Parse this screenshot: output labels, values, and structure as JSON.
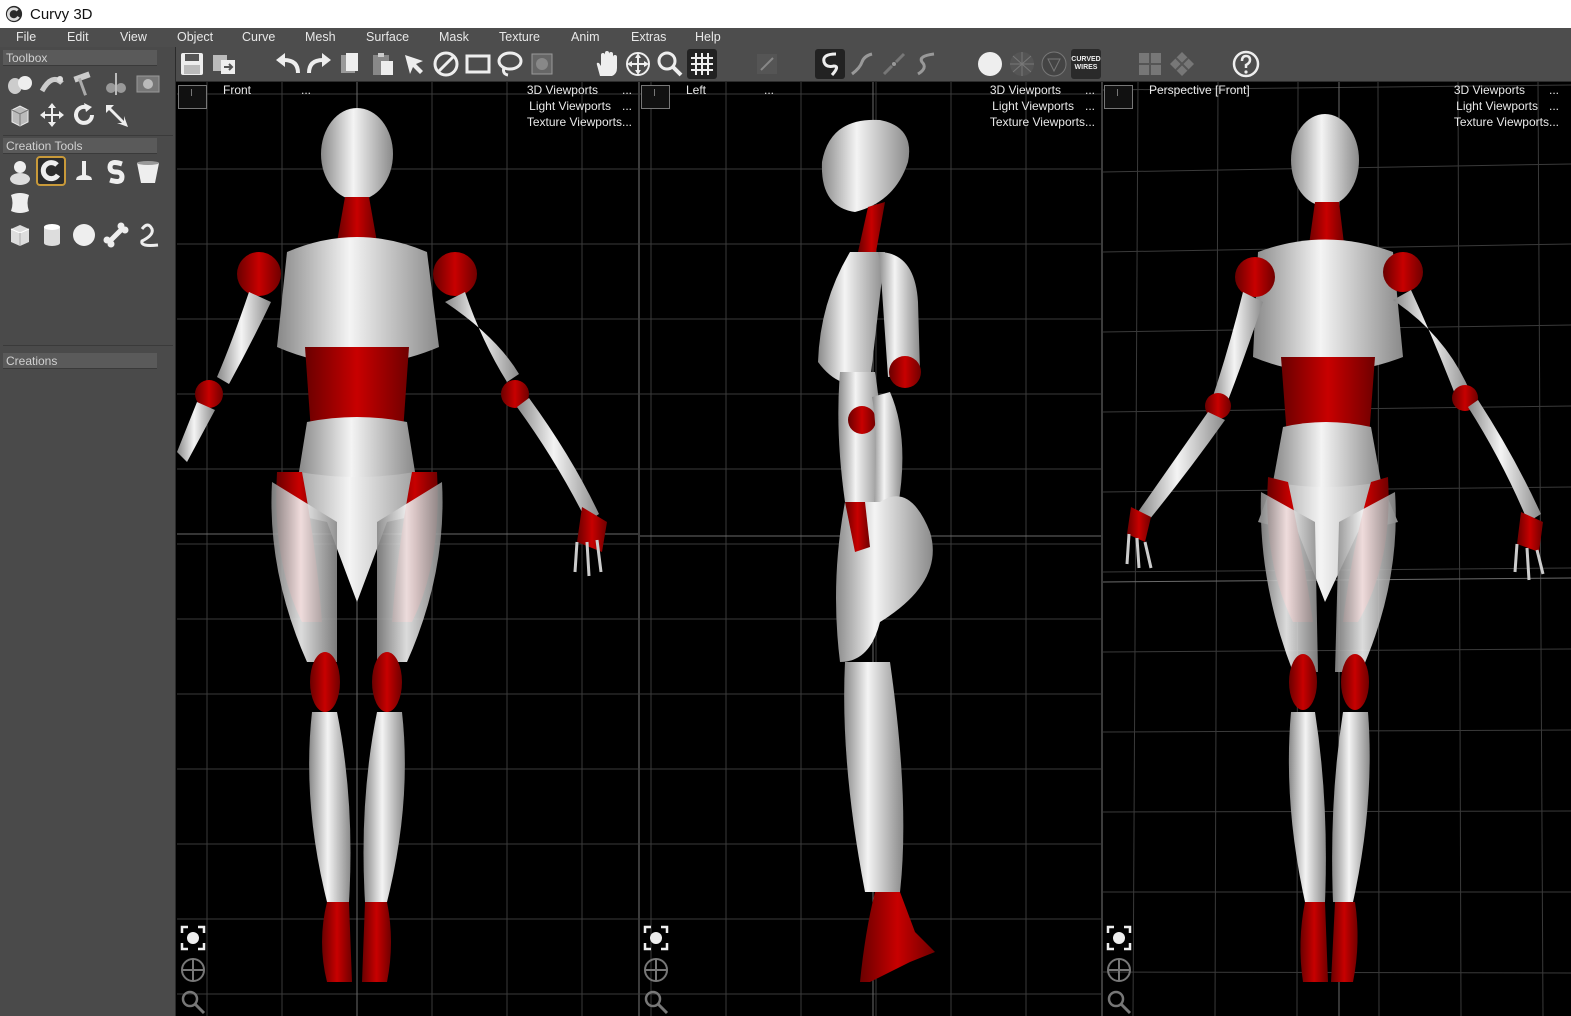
{
  "app": {
    "title": "Curvy 3D",
    "icon": "curvy-logo-icon"
  },
  "menu": [
    "File",
    "Edit",
    "View",
    "Object",
    "Curve",
    "Mesh",
    "Surface",
    "Mask",
    "Texture",
    "Anim",
    "Extras",
    "Help"
  ],
  "left_panel": {
    "toolbox_label": "Toolbox",
    "creation_tools_label": "Creation Tools",
    "creations_label": "Creations",
    "toolbox_icons": [
      "merge-objects-icon",
      "lathe-icon",
      "hammer-icon",
      "cut-icon",
      "render-icon",
      "cube-view-icon",
      "move-icon",
      "rotate-icon",
      "scale-icon"
    ],
    "creation_icons": [
      "blob-tool-icon",
      "curve-tool-icon",
      "extrude-tool-icon",
      "spring-tool-icon",
      "cup-tool-icon",
      "cloth-tool-icon",
      "cube-tool-icon",
      "cylinder-tool-icon",
      "sphere-tool-icon",
      "bone-tool-icon",
      "pipe-tool-icon"
    ],
    "selected_tool": "curve-tool-icon"
  },
  "toolbar": {
    "curved_wires_label": "CURVED\nWIRES",
    "curved_wires_line1": "CURVED",
    "curved_wires_line2": "WIRES"
  },
  "viewports": [
    {
      "name": "Front",
      "dots": "...",
      "menu": [
        "3D Viewports",
        "Light Viewports",
        "Texture Viewports..."
      ],
      "menu_dots": [
        "...",
        "..."
      ]
    },
    {
      "name": "Left",
      "dots": "...",
      "menu": [
        "3D Viewports",
        "Light Viewports",
        "Texture Viewports..."
      ],
      "menu_dots": [
        "...",
        "..."
      ]
    },
    {
      "name": "Perspective [Front]",
      "dots": "",
      "menu": [
        "3D Viewports",
        "Light Viewports",
        "Texture Viewports..."
      ],
      "menu_dots": [
        "...",
        "..."
      ]
    }
  ],
  "colors": {
    "panel_bg": "#4a4a4a",
    "viewport_bg": "#000000",
    "grid": "#3a3a3a",
    "model_silver": "#c8c8c8",
    "model_red": "#b00000",
    "selected_accent": "#c99a3a"
  }
}
